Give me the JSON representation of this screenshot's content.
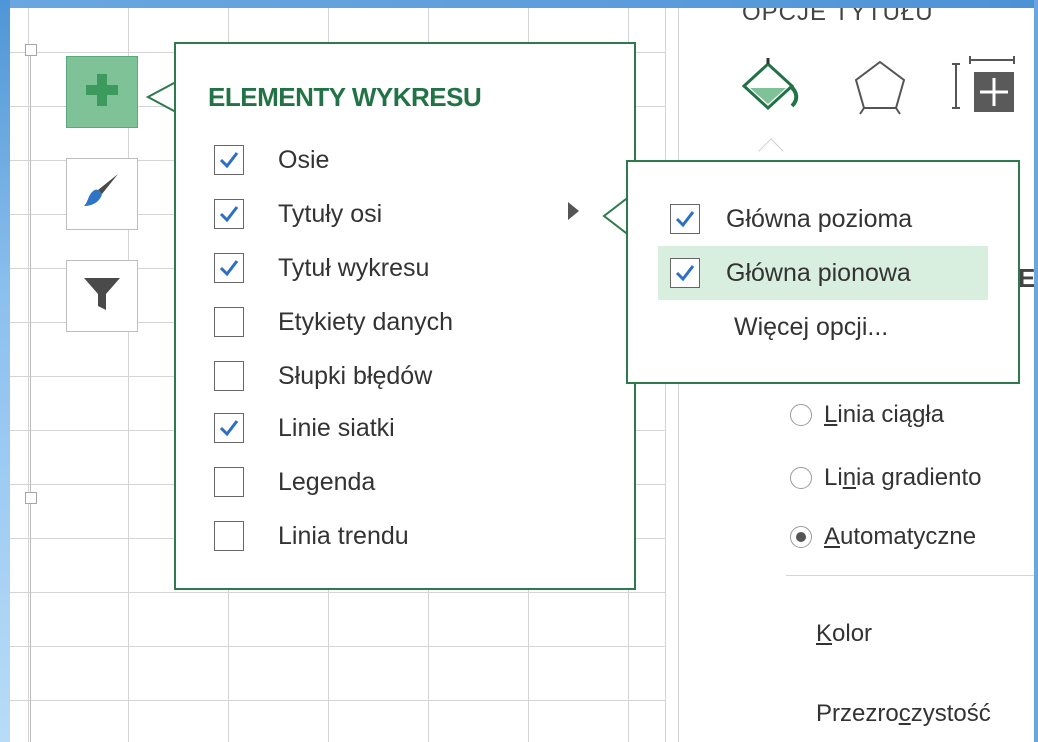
{
  "chart_elements_popup": {
    "heading": "ELEMENTY WYKRESU",
    "items": [
      {
        "label": "Osie",
        "checked": true
      },
      {
        "label": "Tytuły osi",
        "checked": true,
        "has_submenu": true
      },
      {
        "label": "Tytuł wykresu",
        "checked": true
      },
      {
        "label": "Etykiety danych",
        "checked": false
      },
      {
        "label": "Słupki błędów",
        "checked": false
      },
      {
        "label": "Linie siatki",
        "checked": true
      },
      {
        "label": "Legenda",
        "checked": false
      },
      {
        "label": "Linia trendu",
        "checked": false
      }
    ]
  },
  "axis_titles_submenu": {
    "items": [
      {
        "label": "Główna pozioma",
        "checked": true,
        "highlighted": false
      },
      {
        "label": "Główna pionowa",
        "checked": true,
        "highlighted": true
      }
    ],
    "more_options": "Więcej opcji..."
  },
  "side_buttons": {
    "add": "plus-icon",
    "style": "brush-icon",
    "filter": "filter-icon"
  },
  "format_pane": {
    "title_clipped": "OPCJE TYTUŁU",
    "icons": [
      "fill-line-icon",
      "effects-pentagon-icon",
      "size-properties-icon"
    ],
    "section_letter": "E",
    "line_options": [
      {
        "pre": "",
        "u": "L",
        "post": "inia ciągła",
        "selected": false
      },
      {
        "pre": "Li",
        "u": "n",
        "post": "ia gradiento",
        "selected": false
      },
      {
        "pre": "",
        "u": "A",
        "post": "utomatyczne",
        "selected": true
      }
    ],
    "kolor": {
      "u": "K",
      "post": "olor"
    },
    "przezroczystosc": {
      "pre": "Przezro",
      "u": "c",
      "post": "zystość"
    }
  },
  "colors": {
    "accent_green": "#217346",
    "popup_border": "#2f7a4c",
    "highlight": "#d8efe0",
    "add_button": "#7fc297",
    "check_blue": "#2b6fc7"
  }
}
